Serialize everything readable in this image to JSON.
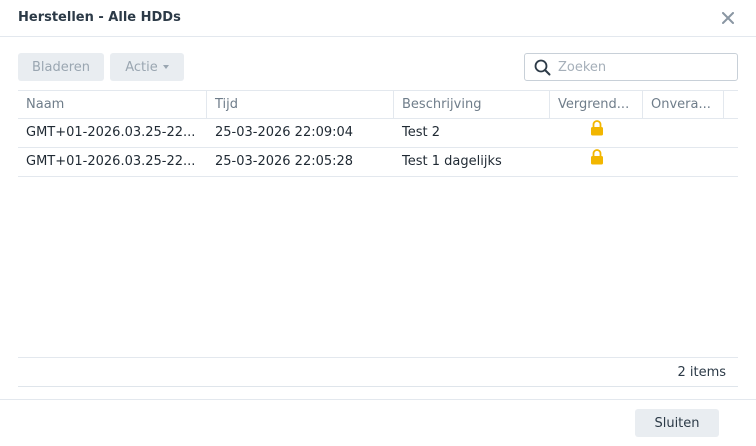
{
  "dialog": {
    "title": "Herstellen - Alle HDDs"
  },
  "toolbar": {
    "browse_label": "Bladeren",
    "action_label": "Actie"
  },
  "search": {
    "placeholder": "Zoeken",
    "value": ""
  },
  "table": {
    "columns": [
      "Naam",
      "Tijd",
      "Beschrijving",
      "Vergrend...",
      "Onvera..."
    ],
    "rows": [
      {
        "name": "GMT+01-2026.03.25-22...",
        "time": "25-03-2026 22:09:04",
        "description": "Test 2",
        "locked_icon": "lock-icon",
        "unchanged": ""
      },
      {
        "name": "GMT+01-2026.03.25-22...",
        "time": "25-03-2026 22:05:28",
        "description": "Test 1 dagelijks",
        "locked_icon": "lock-icon",
        "unchanged": ""
      }
    ],
    "item_count": "2 items"
  },
  "footer": {
    "close_label": "Sluiten"
  },
  "colors": {
    "lock": "#f2b600",
    "accent_text": "#2c3a47",
    "disabled_text": "#9aa6b1",
    "button_bg": "#e9edf1"
  }
}
